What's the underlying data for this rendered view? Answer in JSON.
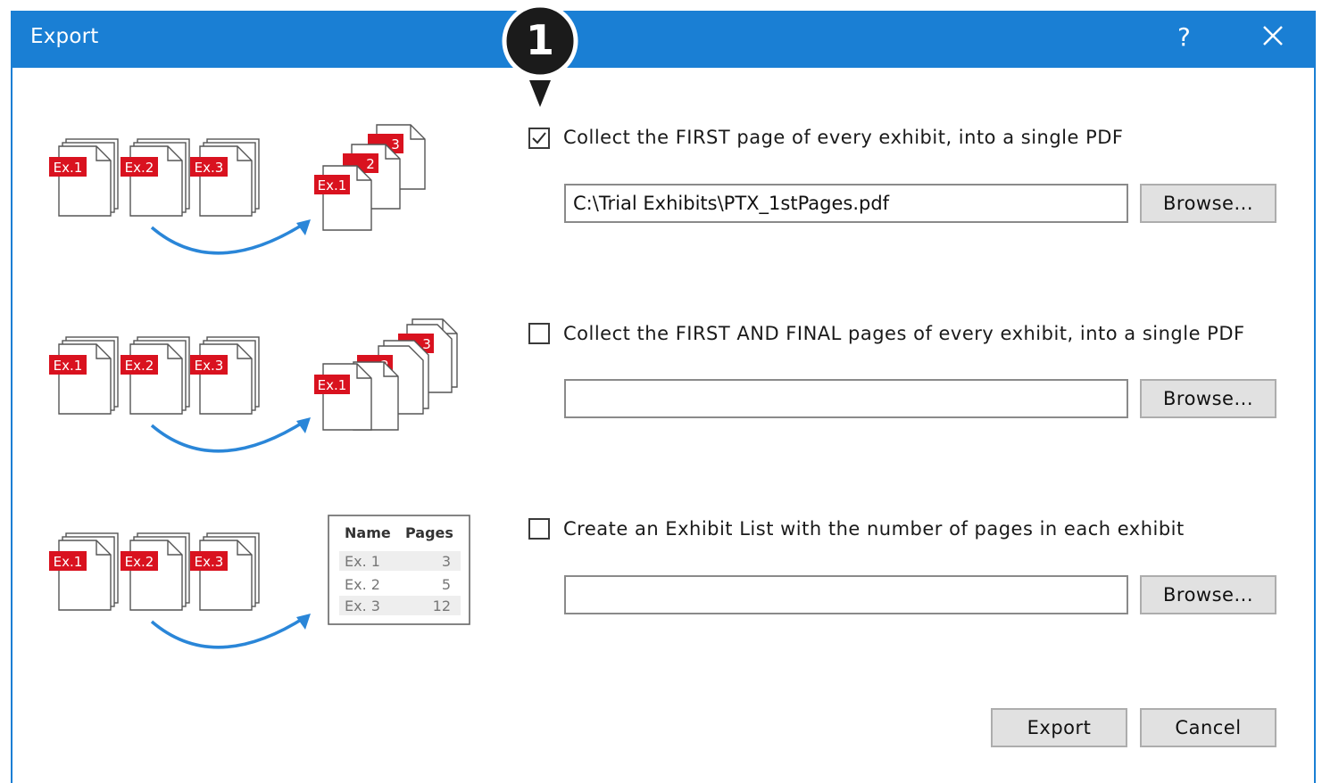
{
  "window": {
    "title": "Export",
    "help_label": "?",
    "accent_color": "#1a7fd4"
  },
  "callout": {
    "number": "1"
  },
  "exhibit_labels": [
    "Ex.1",
    "Ex.2",
    "Ex.3"
  ],
  "stack_labels": [
    "3",
    "2",
    "1"
  ],
  "options": [
    {
      "label": "Collect the FIRST page of every exhibit, into a single PDF",
      "checked": true,
      "path": "C:\\Trial Exhibits\\PTX_1stPages.pdf",
      "browse_label": "Browse..."
    },
    {
      "label": "Collect the FIRST AND FINAL pages of every exhibit, into a single PDF",
      "checked": false,
      "path": "",
      "browse_label": "Browse..."
    },
    {
      "label": "Create an Exhibit List with the number of pages in each exhibit",
      "checked": false,
      "path": "",
      "browse_label": "Browse..."
    }
  ],
  "exhibit_table": {
    "headers": [
      "Name",
      "Pages"
    ],
    "rows": [
      [
        "Ex. 1",
        "3"
      ],
      [
        "Ex. 2",
        "5"
      ],
      [
        "Ex. 3",
        "12"
      ]
    ]
  },
  "footer": {
    "export_label": "Export",
    "cancel_label": "Cancel"
  }
}
